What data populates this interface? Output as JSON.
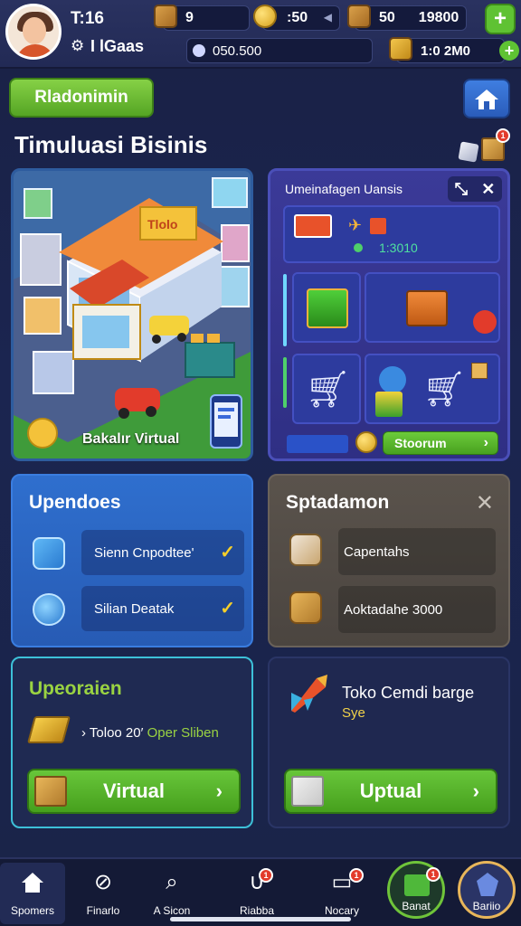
{
  "status": {
    "time": "T:16",
    "username": "I lGaas"
  },
  "resources": {
    "crates_count": "9",
    "coins_count": ":50",
    "boxes_count": "50",
    "total": "19800",
    "gems": "050.500",
    "gold": "1:0 2M0"
  },
  "header": {
    "green_button": "Rladonimin",
    "title": "Timuluasi Bisinis",
    "box_badge": "1"
  },
  "city": {
    "sign": "Tlolo",
    "caption": "Bakalır Virtual"
  },
  "market": {
    "title": "Umeinafagen Uansis",
    "item_value": "1:3010",
    "store_button": "Stoorum"
  },
  "updates": {
    "heading": "Upendoes",
    "items": [
      {
        "label": "Sienn Cnpodtee'"
      },
      {
        "label": "Silian Deatak"
      }
    ]
  },
  "special": {
    "heading": "Sptadamon",
    "items": [
      {
        "label": "Capentahs"
      },
      {
        "label": "Aoktadahe 3000"
      }
    ]
  },
  "operations": {
    "heading": "Upeoraien",
    "line_prefix": "› Toloo 20′ ",
    "line_highlight": "Oper Sliben",
    "button": "Virtual"
  },
  "store": {
    "name": "Toko Cemdi barge",
    "sub": "Sye",
    "button": "Uptual"
  },
  "nav": {
    "items": [
      {
        "label": "Spomers"
      },
      {
        "label": "Finarlo"
      },
      {
        "label": "A Sicon"
      },
      {
        "label": "Riabba"
      },
      {
        "label": "Nocary"
      },
      {
        "label": "Banat"
      },
      {
        "label": "Bariio"
      }
    ],
    "badges": [
      "1",
      "1",
      "1"
    ]
  },
  "colors": {
    "accent_green": "#5fc233",
    "panel_blue": "#2f6fce",
    "badge_red": "#e23b2b",
    "highlight_yellow": "#f5cf2a"
  }
}
